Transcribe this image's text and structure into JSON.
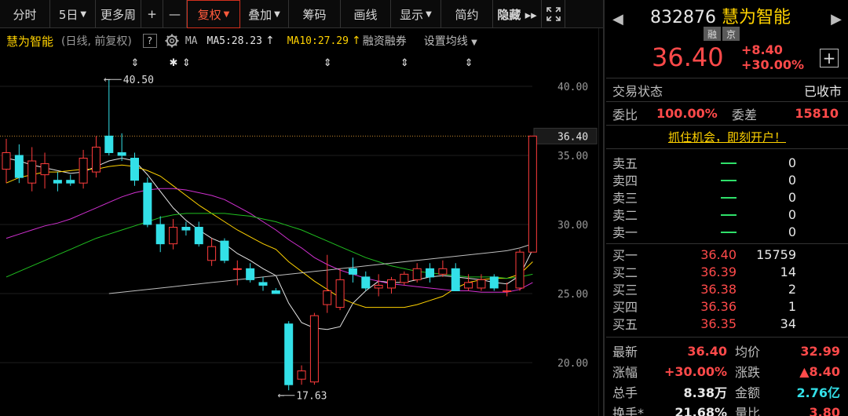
{
  "toolbar": {
    "items": [
      {
        "label": "分时",
        "w": 64,
        "caret": false
      },
      {
        "label": "5日",
        "w": 58,
        "caret": true
      },
      {
        "label": "更多周",
        "w": 58,
        "caret": false
      },
      {
        "label": "+",
        "w": 28,
        "caret": false
      },
      {
        "label": "—",
        "w": 30,
        "caret": false
      },
      {
        "label": "复权",
        "w": 68,
        "caret": true,
        "active": true
      },
      {
        "label": "叠加",
        "w": 62,
        "caret": true
      },
      {
        "label": "筹码",
        "w": 66,
        "caret": false
      },
      {
        "label": "画线",
        "w": 64,
        "caret": false
      },
      {
        "label": "显示",
        "w": 64,
        "caret": true
      },
      {
        "label": "简约",
        "w": 66,
        "caret": false
      },
      {
        "label": "隐藏 ▸▸",
        "w": 62,
        "caret": false,
        "bold": true
      }
    ],
    "fullscreen_icon": "expand-icon"
  },
  "chart_header": {
    "name": "慧为智能",
    "period": "(日线, 前复权)",
    "help": "?",
    "ma": "MA",
    "ma5": "MA5:28.23",
    "ma10": "MA10:27.29",
    "finance": "融资融券",
    "setting": "设置均线"
  },
  "chart_data": {
    "type": "candlestick",
    "ylim": [
      17,
      42
    ],
    "yticks": [
      "40.00",
      "35.00",
      "30.00",
      "25.00",
      "20.00"
    ],
    "ytick_values": [
      40,
      35,
      30,
      25,
      20
    ],
    "current_price_label": "36.40",
    "current_price": 36.4,
    "high_annotation": {
      "label": "40.50",
      "value": 40.5,
      "index": 7
    },
    "low_annotation": {
      "label": "17.63",
      "value": 17.63,
      "index": 21
    },
    "event_markers": [
      {
        "index": 10,
        "symbol": "⇕"
      },
      {
        "index": 13,
        "symbol": "✱"
      },
      {
        "index": 14,
        "symbol": "⇕"
      },
      {
        "index": 25,
        "symbol": "⇕"
      },
      {
        "index": 31,
        "symbol": "⇕"
      },
      {
        "index": 36,
        "symbol": "⇕"
      }
    ],
    "candles": [
      {
        "o": 34.0,
        "h": 36.2,
        "l": 33.0,
        "c": 35.2
      },
      {
        "o": 35.0,
        "h": 35.8,
        "l": 33.0,
        "c": 33.4
      },
      {
        "o": 33.0,
        "h": 35.6,
        "l": 32.4,
        "c": 34.6
      },
      {
        "o": 33.6,
        "h": 35.2,
        "l": 32.6,
        "c": 34.4
      },
      {
        "o": 33.2,
        "h": 33.8,
        "l": 32.4,
        "c": 33.0
      },
      {
        "o": 33.2,
        "h": 33.6,
        "l": 32.8,
        "c": 33.0
      },
      {
        "o": 33.0,
        "h": 35.4,
        "l": 32.6,
        "c": 34.8
      },
      {
        "o": 33.8,
        "h": 36.4,
        "l": 33.4,
        "c": 35.6
      },
      {
        "o": 36.4,
        "h": 40.5,
        "l": 35.0,
        "c": 35.2
      },
      {
        "o": 35.2,
        "h": 36.6,
        "l": 34.6,
        "c": 35.0
      },
      {
        "o": 34.8,
        "h": 35.2,
        "l": 32.8,
        "c": 33.2
      },
      {
        "o": 33.0,
        "h": 33.4,
        "l": 29.8,
        "c": 30.0
      },
      {
        "o": 30.0,
        "h": 30.6,
        "l": 28.0,
        "c": 28.6
      },
      {
        "o": 28.6,
        "h": 30.4,
        "l": 28.2,
        "c": 29.8
      },
      {
        "o": 29.8,
        "h": 30.2,
        "l": 29.2,
        "c": 29.6
      },
      {
        "o": 29.8,
        "h": 30.2,
        "l": 28.4,
        "c": 28.6
      },
      {
        "o": 27.4,
        "h": 29.0,
        "l": 27.0,
        "c": 28.4
      },
      {
        "o": 28.8,
        "h": 29.0,
        "l": 27.2,
        "c": 27.4
      },
      {
        "o": 26.8,
        "h": 27.4,
        "l": 25.6,
        "c": 26.8
      },
      {
        "o": 26.8,
        "h": 27.2,
        "l": 25.8,
        "c": 26.0
      },
      {
        "o": 25.8,
        "h": 26.2,
        "l": 25.2,
        "c": 25.6
      },
      {
        "o": 25.2,
        "h": 25.4,
        "l": 25.0,
        "c": 25.0
      },
      {
        "o": 22.8,
        "h": 23.0,
        "l": 18.0,
        "c": 18.4
      },
      {
        "o": 18.8,
        "h": 19.8,
        "l": 18.4,
        "c": 19.4
      },
      {
        "o": 18.6,
        "h": 23.6,
        "l": 18.4,
        "c": 23.4
      },
      {
        "o": 24.2,
        "h": 27.8,
        "l": 23.6,
        "c": 25.2
      },
      {
        "o": 24.0,
        "h": 26.8,
        "l": 23.8,
        "c": 26.0
      },
      {
        "o": 26.8,
        "h": 27.6,
        "l": 25.8,
        "c": 26.4
      },
      {
        "o": 26.2,
        "h": 26.6,
        "l": 25.2,
        "c": 25.4
      },
      {
        "o": 25.4,
        "h": 26.4,
        "l": 24.8,
        "c": 25.6
      },
      {
        "o": 25.4,
        "h": 26.2,
        "l": 25.0,
        "c": 26.0
      },
      {
        "o": 25.8,
        "h": 26.6,
        "l": 25.6,
        "c": 26.4
      },
      {
        "o": 26.0,
        "h": 27.2,
        "l": 25.8,
        "c": 26.8
      },
      {
        "o": 26.8,
        "h": 27.2,
        "l": 25.8,
        "c": 26.2
      },
      {
        "o": 26.4,
        "h": 27.4,
        "l": 26.2,
        "c": 26.8
      },
      {
        "o": 26.8,
        "h": 27.2,
        "l": 25.2,
        "c": 25.2
      },
      {
        "o": 25.4,
        "h": 26.4,
        "l": 25.2,
        "c": 25.8
      },
      {
        "o": 25.4,
        "h": 26.4,
        "l": 25.2,
        "c": 26.0
      },
      {
        "o": 26.2,
        "h": 26.4,
        "l": 25.2,
        "c": 25.4
      },
      {
        "o": 25.2,
        "h": 25.8,
        "l": 24.8,
        "c": 25.2
      },
      {
        "o": 25.4,
        "h": 28.2,
        "l": 25.2,
        "c": 28.0
      },
      {
        "o": 28.0,
        "h": 36.4,
        "l": 28.0,
        "c": 36.4
      }
    ],
    "series": [
      {
        "key": "ma5",
        "color": "#e6e6e6",
        "values": [
          34.8,
          34.6,
          34.3,
          34.1,
          33.9,
          33.7,
          33.8,
          34.2,
          34.6,
          34.8,
          34.6,
          33.6,
          32.4,
          31.2,
          30.3,
          29.6,
          29.0,
          28.6,
          27.9,
          27.4,
          26.8,
          26.3,
          24.3,
          22.9,
          22.5,
          22.4,
          22.6,
          24.3,
          25.2,
          25.9,
          25.8,
          25.8,
          26.0,
          26.2,
          26.3,
          26.2,
          26.1,
          26.0,
          25.8,
          25.7,
          26.3,
          28.2
        ]
      },
      {
        "key": "ma10",
        "color": "#ffd200",
        "values": [
          33.0,
          33.4,
          33.6,
          33.8,
          33.8,
          33.9,
          34.0,
          34.0,
          34.2,
          34.3,
          34.2,
          33.9,
          33.5,
          32.8,
          32.1,
          31.4,
          30.8,
          30.2,
          29.6,
          29.1,
          28.6,
          28.2,
          27.3,
          26.6,
          25.9,
          25.3,
          24.7,
          24.3,
          24.0,
          24.0,
          24.0,
          24.0,
          24.2,
          24.5,
          24.8,
          25.4,
          25.8,
          26.0,
          26.1,
          26.1,
          26.4,
          27.3
        ]
      },
      {
        "key": "ma20",
        "color": "#d030d0",
        "values": [
          29.0,
          29.3,
          29.6,
          29.9,
          30.1,
          30.4,
          30.8,
          31.2,
          31.6,
          32.0,
          32.3,
          32.5,
          32.6,
          32.6,
          32.5,
          32.3,
          32.1,
          31.8,
          31.3,
          30.8,
          30.2,
          29.6,
          28.9,
          28.3,
          27.6,
          27.1,
          26.7,
          26.4,
          26.1,
          25.9,
          25.7,
          25.6,
          25.5,
          25.4,
          25.3,
          25.2,
          25.2,
          25.1,
          25.1,
          25.1,
          25.3,
          25.8
        ]
      },
      {
        "key": "ma30",
        "color": "#20c020",
        "values": [
          26.2,
          26.6,
          27.0,
          27.4,
          27.8,
          28.2,
          28.6,
          29.0,
          29.3,
          29.6,
          29.9,
          30.2,
          30.5,
          30.7,
          30.8,
          30.8,
          30.8,
          30.8,
          30.7,
          30.6,
          30.4,
          30.2,
          29.9,
          29.6,
          29.2,
          28.8,
          28.4,
          28.0,
          27.6,
          27.3,
          27.0,
          26.8,
          26.6,
          26.5,
          26.4,
          26.3,
          26.2,
          26.2,
          26.2,
          26.1,
          26.2,
          26.4
        ]
      },
      {
        "key": "ma60",
        "color": "#bdbdbd",
        "start": 8,
        "values": [
          25.0,
          25.1,
          25.2,
          25.3,
          25.4,
          25.5,
          25.6,
          25.7,
          25.8,
          25.9,
          26.0,
          26.1,
          26.2,
          26.3,
          26.4,
          26.5,
          26.6,
          26.7,
          26.8,
          26.9,
          27.0,
          27.1,
          27.2,
          27.3,
          27.4,
          27.5,
          27.6,
          27.7,
          27.8,
          27.9,
          28.0,
          28.1,
          28.3,
          28.6
        ]
      }
    ]
  },
  "quote": {
    "code": "832876",
    "name": "慧为智能",
    "tags": [
      "融",
      "京"
    ],
    "price": "36.40",
    "change": "+8.40",
    "change_pct": "+30.00%",
    "status_label": "交易状态",
    "status_value": "已收市",
    "weibi_label": "委比",
    "weibi_value": "100.00%",
    "weicha_label": "委差",
    "weicha_value": "15810",
    "promo": "抓住机会，即刻开户！",
    "asks": [
      {
        "label": "卖五",
        "price": "",
        "vol": "0"
      },
      {
        "label": "卖四",
        "price": "",
        "vol": "0"
      },
      {
        "label": "卖三",
        "price": "",
        "vol": "0"
      },
      {
        "label": "卖二",
        "price": "",
        "vol": "0"
      },
      {
        "label": "卖一",
        "price": "",
        "vol": "0"
      }
    ],
    "bids": [
      {
        "label": "买一",
        "price": "36.40",
        "vol": "15759"
      },
      {
        "label": "买二",
        "price": "36.39",
        "vol": "14"
      },
      {
        "label": "买三",
        "price": "36.38",
        "vol": "2"
      },
      {
        "label": "买四",
        "price": "36.36",
        "vol": "1"
      },
      {
        "label": "买五",
        "price": "36.35",
        "vol": "34"
      }
    ],
    "stats": [
      {
        "k": "最新",
        "v": "36.40",
        "vc": "red",
        "k2": "均价",
        "v2": "32.99",
        "v2c": "red"
      },
      {
        "k": "涨幅",
        "v": "+30.00%",
        "vc": "red",
        "k2": "涨跌",
        "v2": "▲8.40",
        "v2c": "red"
      },
      {
        "k": "总手",
        "v": "8.38万",
        "vc": "white",
        "k2": "金额",
        "v2": "2.76亿",
        "v2c": "cyan"
      },
      {
        "k": "换手*",
        "v": "21.68%",
        "vc": "white",
        "k2": "量比",
        "v2": "3.80",
        "v2c": "red"
      }
    ]
  }
}
